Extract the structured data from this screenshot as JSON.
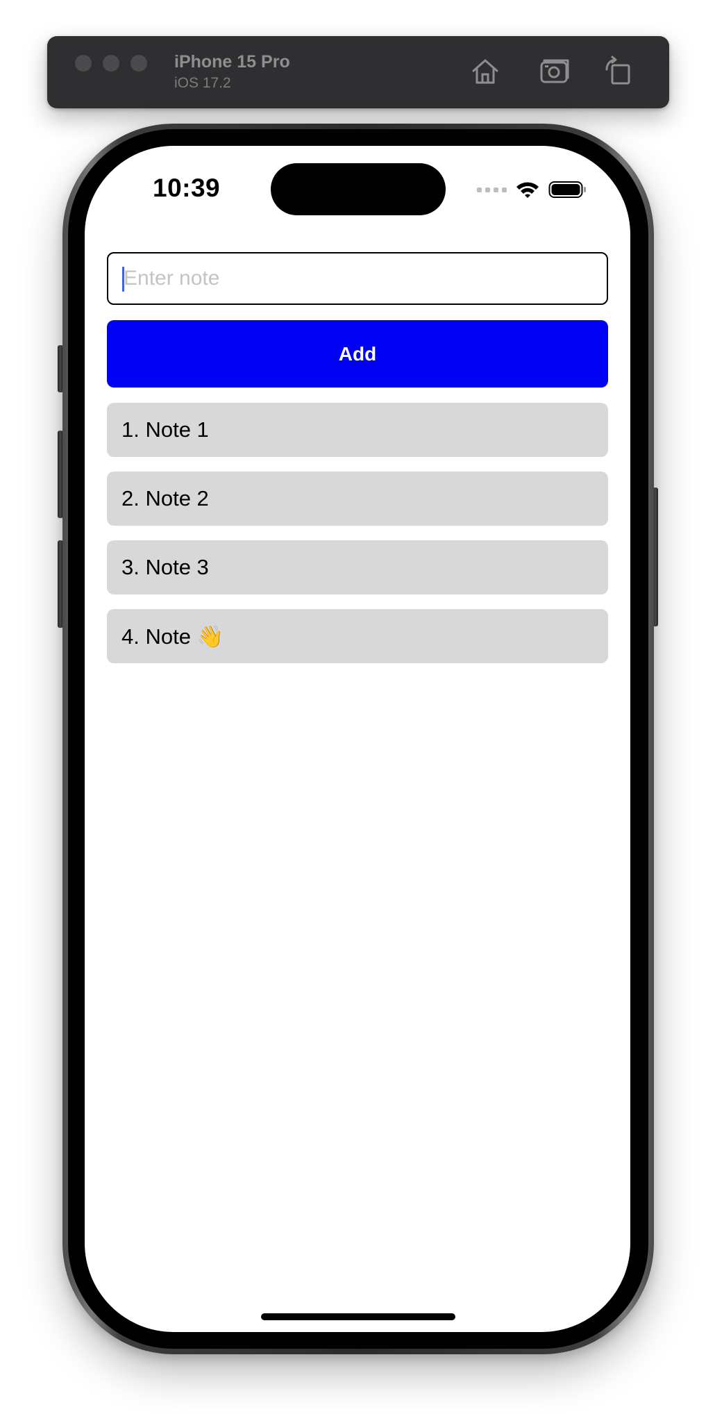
{
  "simulator": {
    "device_name": "iPhone 15 Pro",
    "os_version": "iOS 17.2",
    "toolbar_icons": [
      "home-icon",
      "screenshot-icon",
      "rotate-icon"
    ]
  },
  "status_bar": {
    "time": "10:39",
    "icons": [
      "cellular-signal-icon",
      "wifi-icon",
      "battery-icon"
    ]
  },
  "note_input": {
    "value": "",
    "placeholder": "Enter note"
  },
  "add_button": {
    "label": "Add",
    "color": "#0000f5"
  },
  "notes": [
    "1. Note 1",
    "2. Note 2",
    "3. Note 3",
    "4. Note 👋"
  ],
  "colors": {
    "note_item_background": "#d8d8d8",
    "caret": "#3e5ef5"
  }
}
